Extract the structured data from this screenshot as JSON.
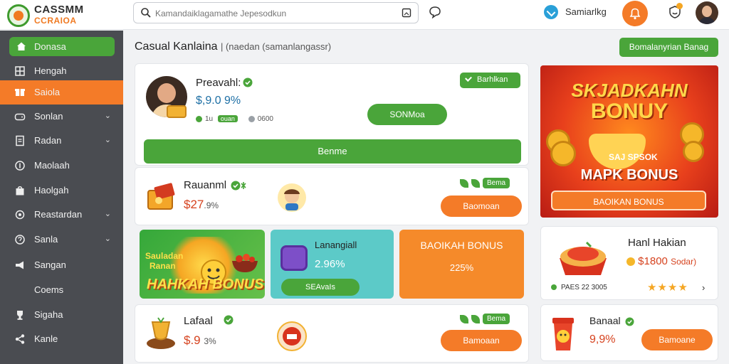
{
  "app": {
    "logo_line1": "CASSMM",
    "logo_line2": "CCRAIOA",
    "search_placeholder": "Kamandaiklagamathe Jepesodkun",
    "user_name": "Samiarlkg",
    "accent_orange": "#f47b28",
    "accent_green": "#4aa53a"
  },
  "sidebar": {
    "items": [
      {
        "label": "Donasa",
        "icon": "home-icon",
        "state": "active-green",
        "chevron": false
      },
      {
        "label": "Hengah",
        "icon": "grid-icon",
        "state": "",
        "chevron": false
      },
      {
        "label": "Saiola",
        "icon": "gift-icon",
        "state": "active-orange",
        "chevron": false
      },
      {
        "label": "Sonlan",
        "icon": "controller-icon",
        "state": "",
        "chevron": true
      },
      {
        "label": "Radan",
        "icon": "document-icon",
        "state": "",
        "chevron": true
      },
      {
        "label": "Maolaah",
        "icon": "coin-icon",
        "state": "",
        "chevron": false
      },
      {
        "label": "Haolgah",
        "icon": "bag-icon",
        "state": "",
        "chevron": false
      },
      {
        "label": "Reastardan",
        "icon": "settings-icon",
        "state": "",
        "chevron": true
      },
      {
        "label": "Sanla",
        "icon": "help-icon",
        "state": "",
        "chevron": true
      },
      {
        "label": "Sangan",
        "icon": "megaphone-icon",
        "state": "",
        "chevron": false
      },
      {
        "label": "Coems",
        "icon": "",
        "state": "",
        "chevron": false
      },
      {
        "label": "Sigaha",
        "icon": "trophy-icon",
        "state": "",
        "chevron": false
      },
      {
        "label": "Kanle",
        "icon": "share-icon",
        "state": "",
        "chevron": false
      }
    ]
  },
  "header": {
    "title": "Casual Kanlaina",
    "subtitle": "| (naedan (samanlangassr)",
    "cta_label": "Bomalanyrian Banag"
  },
  "profile": {
    "name": "Preavahl:",
    "balance": "$,9.0 9%",
    "meta_a": "1u",
    "meta_chip": "ouan",
    "meta_b": "0600",
    "tag_label": "Barhlkan",
    "mid_button": "SONMoa",
    "wide_button": "Benme"
  },
  "rows": [
    {
      "title": "Rauanml",
      "value": "$27",
      "value_small": ".9%",
      "chip": "Bema",
      "button": "Baomoan"
    },
    {
      "title": "Lafaal",
      "value": "$.9",
      "value_small": "3%",
      "chip": "Bema",
      "button": "Bamoaan"
    }
  ],
  "tiles": {
    "a_line1": "Sauladan",
    "a_line2": "Ranan",
    "a_line3": "HAHKAH BONUS",
    "b_title": "Lanangiall",
    "b_value": "2.96%",
    "b_button": "SEAvaIs",
    "c_title": "BAOIKAH BONUS",
    "c_value": "225%"
  },
  "hero": {
    "line1": "SKJADKAHN",
    "line2": "BONUY",
    "line3": "SAJ SPSOK",
    "line4": "MAPK BONUS",
    "cta": "BAOIKAN BONUS"
  },
  "right_cards": {
    "card1_title": "Hanl Hakian",
    "card1_value": "$1800",
    "card1_value_small": "Sodar)",
    "card1_meta": "PAES 22 3005",
    "card1_stars": "★★★★",
    "card2_title": "Banaal",
    "card2_value": "9,9%",
    "card2_button": "Bamoane"
  }
}
